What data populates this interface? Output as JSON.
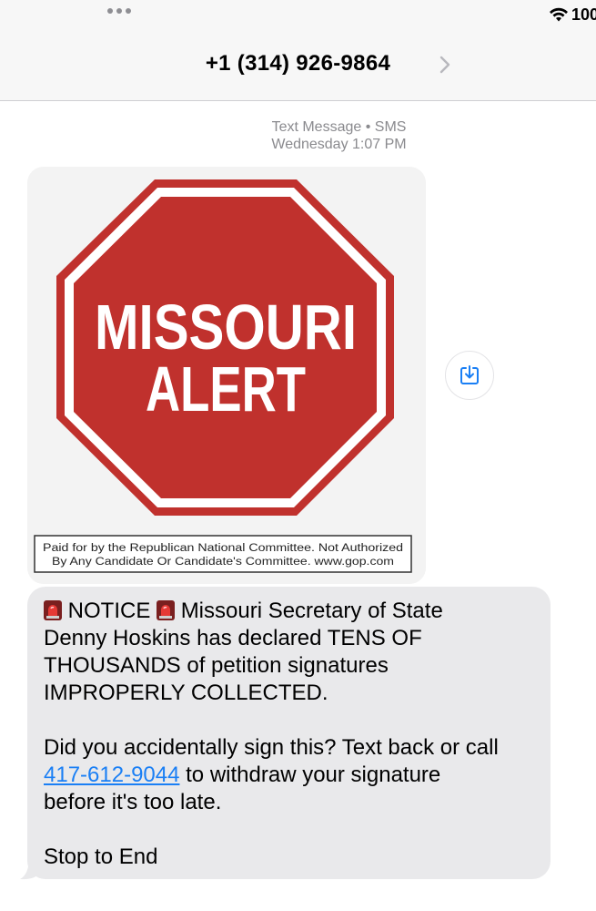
{
  "status_bar": {
    "battery": "100"
  },
  "header": {
    "contact": "+1 (314) 926-9864"
  },
  "thread": {
    "service": "Text Message • SMS",
    "timestamp": "Wednesday 1:07 PM"
  },
  "image": {
    "line1": "MISSOURI",
    "line2": "ALERT",
    "disclaimer1": "Paid for by the Republican National Committee. Not Authorized",
    "disclaimer2": "By Any Candidate Or Candidate's Committee. www.gop.com"
  },
  "message": {
    "notice": "NOTICE",
    "p1a": "Missouri Secretary of State",
    "p1b": "Denny Hoskins has declared TENS OF",
    "p1c": "THOUSANDS of petition signatures",
    "p1d": "IMPROPERLY COLLECTED.",
    "p2a": "Did you accidentally sign this? Text back or call",
    "phone": "417-612-9044",
    "p2b": " to withdraw your signature",
    "p2c": "before it's too late.",
    "p3": "Stop to End"
  },
  "colors": {
    "link": "#1a7ff5",
    "bubble": "#e9e9eb",
    "sign_red": "#c0312d"
  },
  "icons": [
    "more-dots-icon",
    "wifi-icon",
    "chevron-right-icon",
    "save-download-icon",
    "siren-emoji-icon"
  ]
}
